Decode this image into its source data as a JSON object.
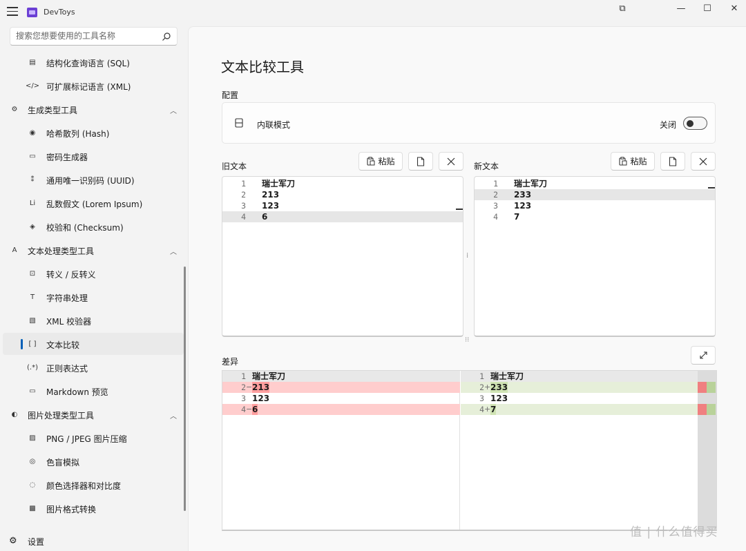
{
  "app": {
    "title": "DevToys"
  },
  "window": {
    "snap_icon": "⧉",
    "minimize": "—",
    "maximize": "☐",
    "close": "✕"
  },
  "sidebar": {
    "search_placeholder": "搜索您想要使用的工具名称",
    "items": [
      {
        "label": "结构化查询语言 (SQL)",
        "icon": "▤",
        "type": "child"
      },
      {
        "label": "可扩展标记语言 (XML)",
        "icon": "</>",
        "type": "child"
      },
      {
        "label": "生成类型工具",
        "icon": "⚙",
        "type": "group"
      },
      {
        "label": "哈希散列 (Hash)",
        "icon": "◉",
        "type": "child"
      },
      {
        "label": "密码生成器",
        "icon": "▭",
        "type": "child"
      },
      {
        "label": "通用唯一识别码 (UUID)",
        "icon": "⁑",
        "type": "child"
      },
      {
        "label": "乱数假文 (Lorem Ipsum)",
        "icon": "Li",
        "type": "child"
      },
      {
        "label": "校验和 (Checksum)",
        "icon": "◈",
        "type": "child"
      },
      {
        "label": "文本处理类型工具",
        "icon": "A",
        "type": "group"
      },
      {
        "label": "转义 / 反转义",
        "icon": "⊡",
        "type": "child"
      },
      {
        "label": "字符串处理",
        "icon": "T",
        "type": "child"
      },
      {
        "label": "XML 校验器",
        "icon": "▧",
        "type": "child"
      },
      {
        "label": "文本比较",
        "icon": "[ ]",
        "type": "child",
        "active": true
      },
      {
        "label": "正则表达式",
        "icon": "(.*)",
        "type": "child"
      },
      {
        "label": "Markdown 预览",
        "icon": "▭",
        "type": "child"
      },
      {
        "label": "图片处理类型工具",
        "icon": "◐",
        "type": "group"
      },
      {
        "label": "PNG / JPEG 图片压缩",
        "icon": "▨",
        "type": "child"
      },
      {
        "label": "色盲模拟",
        "icon": "◎",
        "type": "child"
      },
      {
        "label": "颜色选择器和对比度",
        "icon": "◌",
        "type": "child"
      },
      {
        "label": "图片格式转换",
        "icon": "▩",
        "type": "child"
      }
    ],
    "settings_label": "设置"
  },
  "main": {
    "title": "文本比较工具",
    "config_label": "配置",
    "inline_mode_label": "内联模式",
    "inline_mode_state": "关闭",
    "old_text_label": "旧文本",
    "new_text_label": "新文本",
    "paste_label": "粘贴",
    "diff_label": "差异",
    "old_lines": [
      {
        "n": "1",
        "t": "瑞士军刀"
      },
      {
        "n": "2",
        "t": "213"
      },
      {
        "n": "3",
        "t": "123"
      },
      {
        "n": "4",
        "t": "6"
      }
    ],
    "new_lines": [
      {
        "n": "1",
        "t": "瑞士军刀"
      },
      {
        "n": "2",
        "t": "233"
      },
      {
        "n": "3",
        "t": "123"
      },
      {
        "n": "4",
        "t": "7"
      }
    ],
    "diff_left": [
      {
        "n": "1",
        "m": "",
        "t": "瑞士军刀"
      },
      {
        "n": "2",
        "m": "−",
        "t": "213"
      },
      {
        "n": "3",
        "m": "",
        "t": "123"
      },
      {
        "n": "4",
        "m": "−",
        "t": "6"
      }
    ],
    "diff_right": [
      {
        "n": "1",
        "m": "",
        "t": "瑞士军刀"
      },
      {
        "n": "2",
        "m": "+",
        "t": "233"
      },
      {
        "n": "3",
        "m": "",
        "t": "123"
      },
      {
        "n": "4",
        "m": "+",
        "t": "7"
      }
    ]
  },
  "watermark": "值 | 什么值得买",
  "colors": {
    "accent": "#005fb8",
    "deleted": "#ffcdcd",
    "added": "#e6efd9"
  }
}
